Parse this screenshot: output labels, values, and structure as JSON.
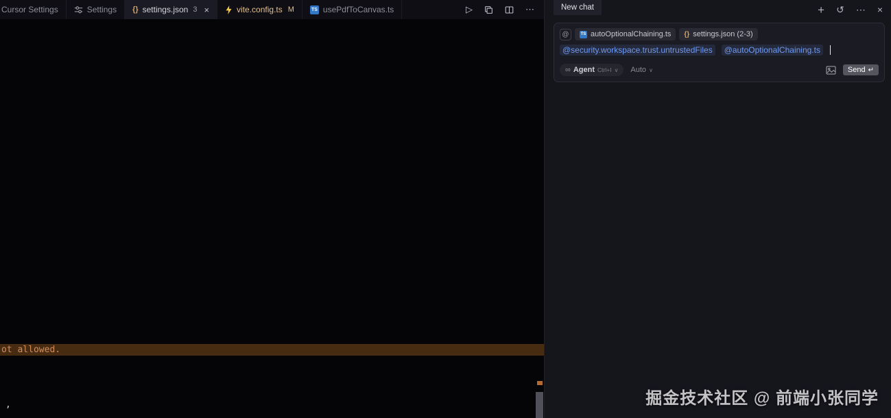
{
  "editor_tabs": {
    "tabs": [
      {
        "label": "Cursor Settings"
      },
      {
        "label": "Settings"
      },
      {
        "label": "settings.json",
        "badge": "3"
      },
      {
        "label": "vite.config.ts",
        "git": "M"
      },
      {
        "label": "usePdfToCanvas.ts"
      }
    ]
  },
  "editor": {
    "highlighted_line_text": "ot allowed.",
    "line_text_comma": ","
  },
  "chat_panel": {
    "tab_label": "New chat",
    "composer": {
      "context_pills": [
        {
          "label": "autoOptionalChaining.ts"
        },
        {
          "label": "settings.json (2-3)"
        }
      ],
      "mentions": [
        {
          "text": "@security.workspace.trust.untrustedFiles"
        },
        {
          "text": "@autoOptionalChaining.ts"
        }
      ],
      "agent_button": {
        "label": "Agent",
        "shortcut": "Ctrl+I"
      },
      "model_selector": "Auto",
      "send_button": "Send"
    }
  },
  "watermark": "掘金技术社区 @ 前端小张同学",
  "icons": {
    "run": "▷",
    "more": "⋯",
    "close": "×",
    "new": "+",
    "history": "↺",
    "at": "@",
    "infinity": "∞",
    "chevron": "∨",
    "return": "↵",
    "braces": "{}",
    "ts_badge": "TS"
  },
  "colors": {
    "accent_blue": "#6f9bf5",
    "modified_yellow": "#e2c08d",
    "json_icon_orange": "#d9a35a",
    "typescript_blue": "#3178c6",
    "vite_bolt_yellow": "#f5c842",
    "highlight_line_bg": "#472c11",
    "highlight_text_orange": "#d18d5e"
  }
}
